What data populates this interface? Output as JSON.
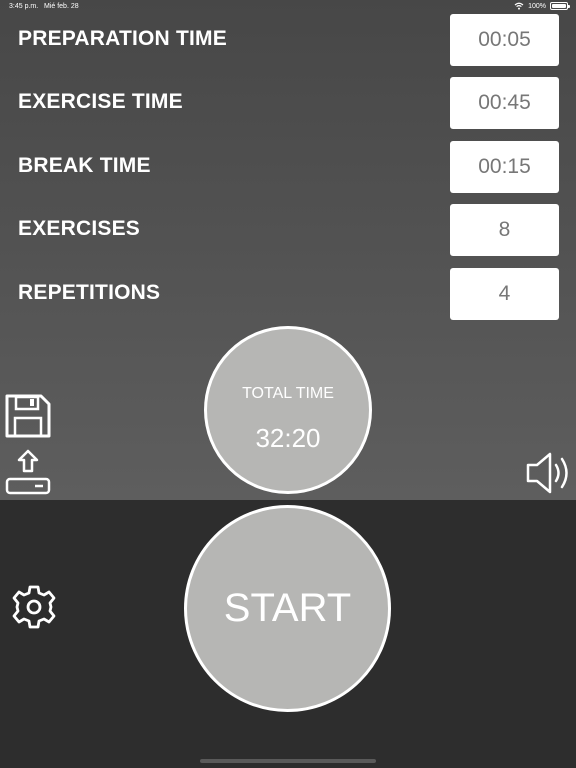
{
  "status_bar": {
    "time": "3:45 p.m.",
    "date": "Mié feb. 28",
    "battery": "100%",
    "icons": [
      "wifi-icon",
      "battery-icon"
    ]
  },
  "settings": [
    {
      "label": "PREPARATION TIME",
      "value": "00:05"
    },
    {
      "label": "EXERCISE TIME",
      "value": "00:45"
    },
    {
      "label": "BREAK TIME",
      "value": "00:15"
    },
    {
      "label": "EXERCISES",
      "value": "8"
    },
    {
      "label": "REPETITIONS",
      "value": "4"
    }
  ],
  "total": {
    "label": "TOTAL TIME",
    "value": "32:20"
  },
  "start_label": "START",
  "icons": {
    "save": "save-icon",
    "load": "upload-icon",
    "sound": "speaker-icon",
    "settings": "gear-icon"
  },
  "colors": {
    "top_background": "#545454",
    "bottom_background": "#2d2d2d",
    "circle_fill": "#b6b6b4",
    "text": "#ffffff",
    "value_text": "#777777"
  }
}
